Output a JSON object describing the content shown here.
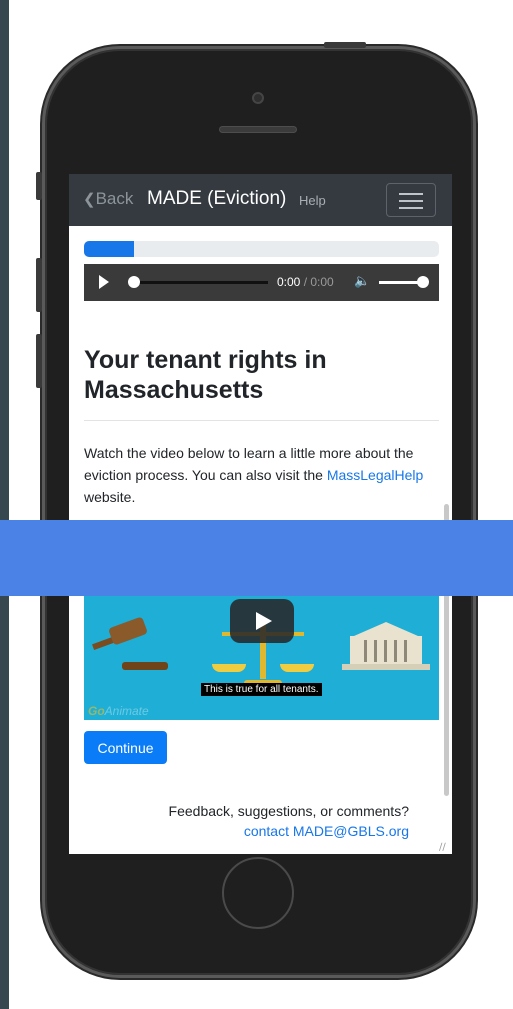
{
  "navbar": {
    "back": "Back",
    "title": "MADE (Eviction)",
    "help": "Help"
  },
  "progress": {
    "percent": 14
  },
  "audio": {
    "current": "0:00",
    "duration": "/ 0:00"
  },
  "page": {
    "heading": "Your tenant rights in Massachusetts",
    "intro_text_1": "Watch the video below to learn a little more about the eviction process. You can also visit the ",
    "intro_link": "MassLegalHelp",
    "intro_text_2": " website."
  },
  "video": {
    "caption": "This is true for all tenants.",
    "watermark_brand": "Go",
    "watermark_rest": "Animate"
  },
  "continue_label": "Continue",
  "footer": {
    "feedback": "Feedback, suggestions, or comments?",
    "contact_link": "contact MADE@GBLS.org"
  },
  "colors": {
    "primary": "#0a7cf7",
    "navbar_bg": "#343a40",
    "banner": "#4a82e6"
  }
}
